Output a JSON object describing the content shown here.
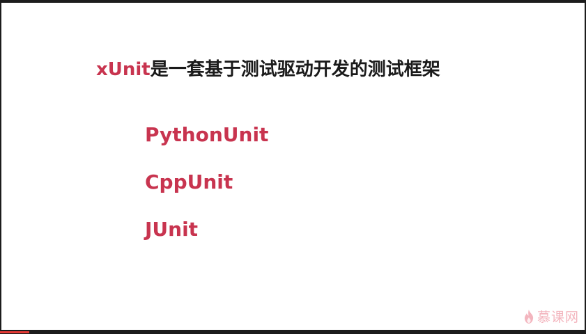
{
  "slide": {
    "title_accent": "xUnit",
    "title_rest": "是一套基于测试驱动开发的测试框架",
    "items": [
      {
        "label": "PythonUnit"
      },
      {
        "label": "CppUnit"
      },
      {
        "label": "JUnit"
      }
    ]
  },
  "watermark": {
    "text": "慕课网",
    "icon": "flame-icon"
  },
  "player": {
    "progress": 0.05
  },
  "colors": {
    "accent": "#c8344f",
    "text": "#1a1a1a",
    "background": "#ffffff",
    "frame": "#1c1c1c",
    "progress": "#e53935"
  }
}
